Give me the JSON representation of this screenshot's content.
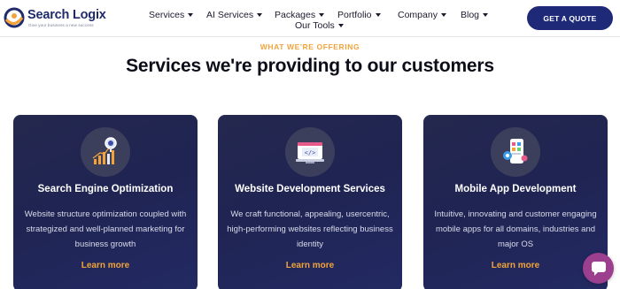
{
  "brand": {
    "name": "Search Logix",
    "tagline": "Give your business a new success"
  },
  "nav": {
    "items": [
      {
        "label": "Services",
        "dropdown": true
      },
      {
        "label": "AI Services",
        "dropdown": true
      },
      {
        "label": "Packages",
        "dropdown": true
      },
      {
        "label": "Portfolio",
        "dropdown": true
      },
      {
        "label": "Company",
        "dropdown": true
      },
      {
        "label": "Blog",
        "dropdown": true
      },
      {
        "label": "Our Tools",
        "dropdown": true
      }
    ],
    "cta_label": "GET A QUOTE"
  },
  "section": {
    "eyebrow": "WHAT WE'RE OFFERING",
    "title": "Services we're providing to our customers"
  },
  "cards": [
    {
      "icon": "seo-chart-magnifier-icon",
      "title": "Search Engine Optimization",
      "description": "Website structure optimization coupled with strategized and well-planned marketing for business growth",
      "link": "Learn more"
    },
    {
      "icon": "code-monitor-icon",
      "title": "Website Development Services",
      "description": "We craft functional, appealing, usercentric, high-performing websites reflecting business identity",
      "link": "Learn more"
    },
    {
      "icon": "mobile-app-icon",
      "title": "Mobile App Development",
      "description": "Intuitive, innovating and customer engaging mobile apps for all domains, industries and major OS",
      "link": "Learn more"
    }
  ],
  "colors": {
    "brand_navy": "#1e2a78",
    "accent_orange": "#f2a33a",
    "card_bg": "#22275a",
    "chat_purple": "#9c3f8e"
  },
  "chat": {
    "icon": "chat-bubble-icon"
  }
}
